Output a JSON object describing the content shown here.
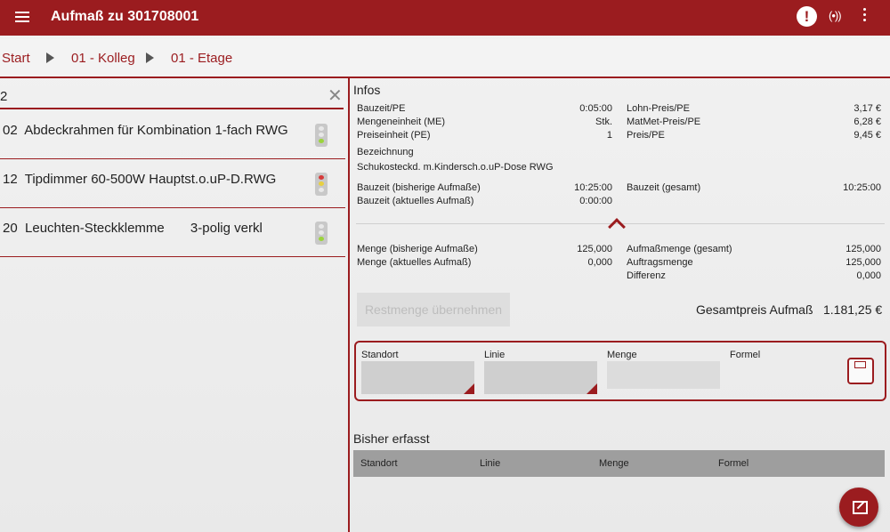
{
  "appbar": {
    "title": "Aufmaß zu 301708001",
    "menu_icon": "menu-icon",
    "alert_icon": "alert-icon",
    "alert_glyph": "!",
    "signal_icon": "signal-icon",
    "signal_glyph": "(•))",
    "more_icon": "more-vert-icon"
  },
  "breadcrumb": [
    "Start",
    "01 - Kolleg",
    "01 - Etage"
  ],
  "search": {
    "value": "2",
    "clear_icon": "close-icon",
    "clear_glyph": "✕"
  },
  "items": [
    {
      "text": "02  Abdeckrahmen für Kombination 1-fach RWG",
      "light": "green"
    },
    {
      "text": "12  Tipdimmer 60-500W Hauptst.o.uP-D.RWG",
      "light": "red-yellow"
    },
    {
      "text": "20  Leuchten-Steckklemme       3-polig verkl",
      "light": "green"
    }
  ],
  "infos": {
    "heading": "Infos",
    "left1": [
      {
        "label": "Bauzeit/PE",
        "value": "0:05:00"
      },
      {
        "label": "Mengeneinheit (ME)",
        "value": "Stk."
      },
      {
        "label": "Preiseinheit (PE)",
        "value": "1"
      }
    ],
    "right1": [
      {
        "label": "Lohn-Preis/PE",
        "value": "3,17 €"
      },
      {
        "label": "MatMet-Preis/PE",
        "value": "6,28 €"
      },
      {
        "label": "Preis/PE",
        "value": "9,45 €"
      }
    ],
    "bezeichnung_label": "Bezeichnung",
    "bezeichnung_value": "Schukosteckd. m.Kindersch.o.uP-Dose RWG",
    "left2": [
      {
        "label": "Bauzeit (bisherige Aufmaße)",
        "value": "10:25:00"
      },
      {
        "label": "Bauzeit (aktuelles Aufmaß)",
        "value": "0:00:00"
      }
    ],
    "right2": [
      {
        "label": "Bauzeit (gesamt)",
        "value": "10:25:00"
      }
    ],
    "left3": [
      {
        "label": "Menge (bisherige Aufmaße)",
        "value": "125,000"
      },
      {
        "label": "Menge (aktuelles Aufmaß)",
        "value": "0,000"
      }
    ],
    "right3": [
      {
        "label": "Aufmaßmenge (gesamt)",
        "value": "125,000"
      },
      {
        "label": "Auftragsmenge",
        "value": "125,000"
      },
      {
        "label": "Differenz",
        "value": "0,000"
      }
    ]
  },
  "rest_button": "Restmenge übernehmen",
  "total": {
    "label": "Gesamtpreis Aufmaß",
    "value": "1.181,25 €"
  },
  "form": {
    "standort": "Standort",
    "linie": "Linie",
    "menge": "Menge",
    "formel": "Formel",
    "save_icon": "save-icon"
  },
  "bisher": {
    "heading": "Bisher erfasst",
    "columns": [
      "Standort",
      "Linie",
      "Menge",
      "Formel"
    ]
  },
  "colors": {
    "accent": "#9b1c1f"
  }
}
